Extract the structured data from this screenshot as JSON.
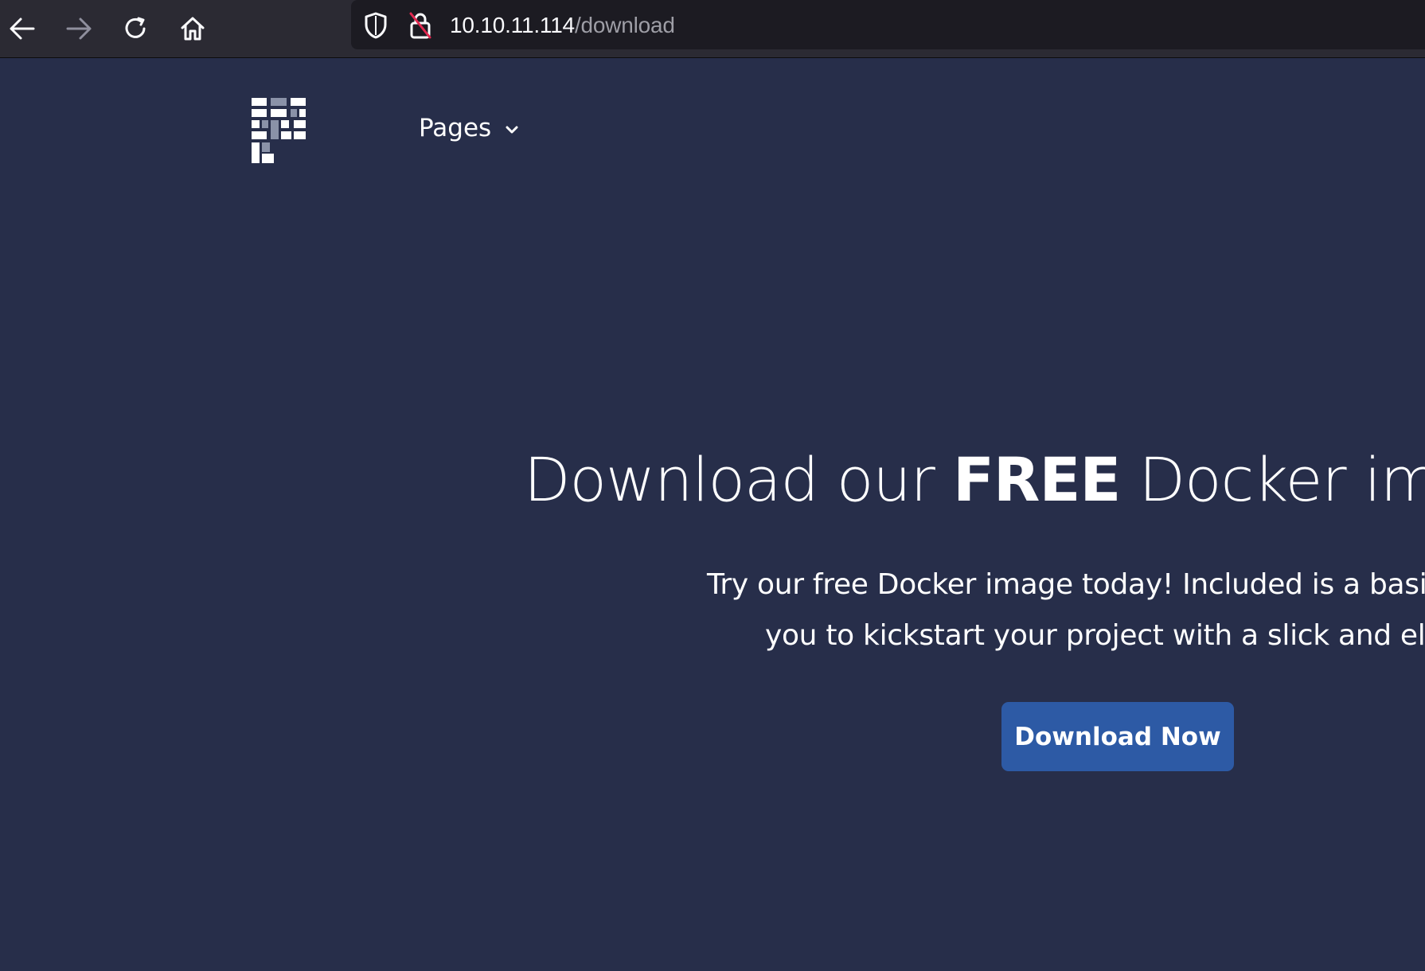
{
  "browser": {
    "url_host": "10.10.11.114",
    "url_path": "/download",
    "icons": [
      "back-arrow-icon",
      "forward-arrow-icon",
      "reload-icon",
      "home-icon",
      "shield-icon",
      "insecure-lock-icon"
    ]
  },
  "nav": {
    "menu_label": "Pages",
    "menu_icon": "chevron-down-icon"
  },
  "hero": {
    "title_prefix": "Download our ",
    "title_bold": "FREE",
    "title_suffix": " Docker ima",
    "desc_line1": "Try our free Docker image today! Included is a basic web pa",
    "desc_line2": "you to kickstart your project with a slick and elogan",
    "button_label": "Download Now"
  },
  "colors": {
    "page_background": "#272e4a",
    "toolbar_background": "#2b2a33",
    "urlbar_background": "#1c1b22",
    "button_background": "#2d5aa5",
    "text": "#ffffff",
    "url_path_text": "#9e9ea6"
  }
}
